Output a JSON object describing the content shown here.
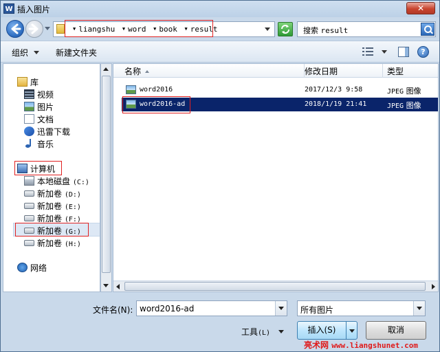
{
  "window": {
    "title": "插入图片",
    "app_icon_letter": "W",
    "close_glyph": "✕"
  },
  "address_bar": {
    "crumbs": [
      "liangshu",
      "word",
      "book",
      "result"
    ]
  },
  "search": {
    "label": "搜索",
    "query": "result"
  },
  "toolbar": {
    "organize": "组织",
    "new_folder": "新建文件夹",
    "help_glyph": "?"
  },
  "nav_pane": {
    "libraries": {
      "label": "库",
      "items": [
        "视频",
        "图片",
        "文档",
        "迅雷下载",
        "音乐"
      ]
    },
    "computer": {
      "label": "计算机",
      "drives": [
        {
          "label": "本地磁盘",
          "letter": "(C:)"
        },
        {
          "label": "新加卷",
          "letter": "(D:)"
        },
        {
          "label": "新加卷",
          "letter": "(E:)"
        },
        {
          "label": "新加卷",
          "letter": "(F:)"
        },
        {
          "label": "新加卷",
          "letter": "(G:)"
        },
        {
          "label": "新加卷",
          "letter": "(H:)"
        }
      ]
    },
    "network": {
      "label": "网络"
    }
  },
  "file_list": {
    "columns": {
      "name": "名称",
      "date": "修改日期",
      "type": "类型"
    },
    "rows": [
      {
        "name": "word2016",
        "date": "2017/12/3 9:58",
        "type_prefix": "JPEG",
        "type_suffix": "图像",
        "selected": false
      },
      {
        "name": "word2016-ad",
        "date": "2018/1/19 21:41",
        "type_prefix": "JPEG",
        "type_suffix": "图像",
        "selected": true
      }
    ]
  },
  "bottom": {
    "filename_label": "文件名(N):",
    "filename_value": "word2016-ad",
    "filter_value": "所有图片",
    "tools_label": "工具",
    "tools_key": "(L)",
    "insert_label": "插入(S)",
    "cancel_label": "取消"
  },
  "watermark": {
    "prefix": "亮术网",
    "url": "www.liangshunet.com"
  }
}
